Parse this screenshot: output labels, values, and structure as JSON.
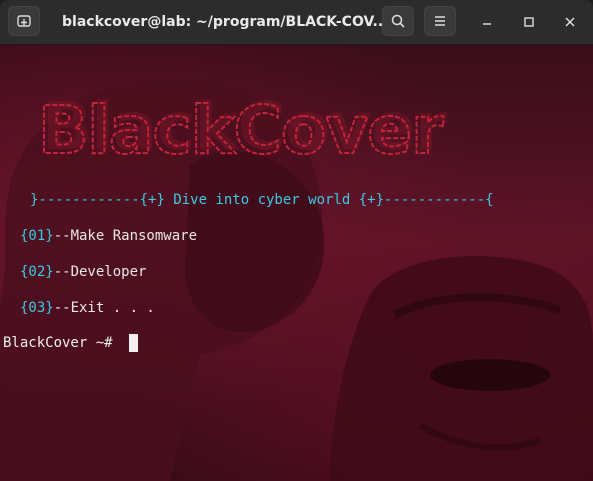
{
  "window": {
    "title": "blackcover@lab: ~/program/BLACK-COV..."
  },
  "logo": {
    "text": "BlackCover",
    "color": "#c4243a"
  },
  "terminal": {
    "banner": {
      "left": "}------------{+}",
      "text": " Dive into cyber world ",
      "right": "{+}------------{"
    },
    "menu": [
      {
        "num": "{01}",
        "label": "--Make Ransomware"
      },
      {
        "num": "{02}",
        "label": "--Developer"
      },
      {
        "num": "{03}",
        "label": "--Exit . . ."
      }
    ],
    "prompt": "BlackCover ~# "
  },
  "colors": {
    "accent": "#3cc9e6",
    "background": "#4a1020",
    "text": "#e8e8e8"
  },
  "icons": {
    "new_tab": "new-tab-icon",
    "search": "search-icon",
    "menu": "hamburger-menu-icon",
    "minimize": "minimize-icon",
    "maximize": "maximize-icon",
    "close": "close-icon"
  }
}
